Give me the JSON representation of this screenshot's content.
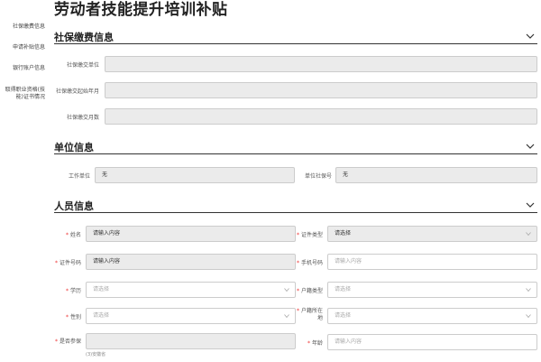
{
  "page_title": "劳动者技能提升培训补贴",
  "sidebar": {
    "items": [
      {
        "label": "社保缴费信息"
      },
      {
        "label": "申请补贴信息"
      },
      {
        "label": "银行账户信息"
      },
      {
        "label": "取得职业资格(技能)证书情况"
      }
    ]
  },
  "sections": {
    "social": {
      "title": "社保缴费信息",
      "fields": {
        "unit": {
          "label": "社保缴交单位",
          "value": ""
        },
        "start": {
          "label": "社保缴交起始年月",
          "value": ""
        },
        "months": {
          "label": "社保缴交月数",
          "value": ""
        }
      }
    },
    "unit": {
      "title": "单位信息",
      "fields": {
        "work_unit": {
          "label": "工作单位",
          "value": "无"
        },
        "unit_no": {
          "label": "单位社保号",
          "value": "无"
        }
      }
    },
    "person": {
      "title": "人员信息",
      "fields": {
        "name": {
          "label": "姓名",
          "value": "请输入内容"
        },
        "id_type": {
          "label": "证件类型",
          "value": "请选择"
        },
        "id_no": {
          "label": "证件号码",
          "value": "请输入内容"
        },
        "phone": {
          "label": "手机号码",
          "placeholder": "请输入内容"
        },
        "education": {
          "label": "学历",
          "placeholder": "请选择"
        },
        "hukou_type": {
          "label": "户籍类型",
          "placeholder": "请选择"
        },
        "gender": {
          "label": "性别",
          "placeholder": "请选择"
        },
        "hukou_place": {
          "label": "户籍所在地",
          "placeholder": "请选择"
        },
        "insured": {
          "label": "是否参保",
          "value": "",
          "hint": "(3)安徽省"
        },
        "age": {
          "label": "年龄",
          "placeholder": "请输入内容"
        }
      }
    }
  }
}
